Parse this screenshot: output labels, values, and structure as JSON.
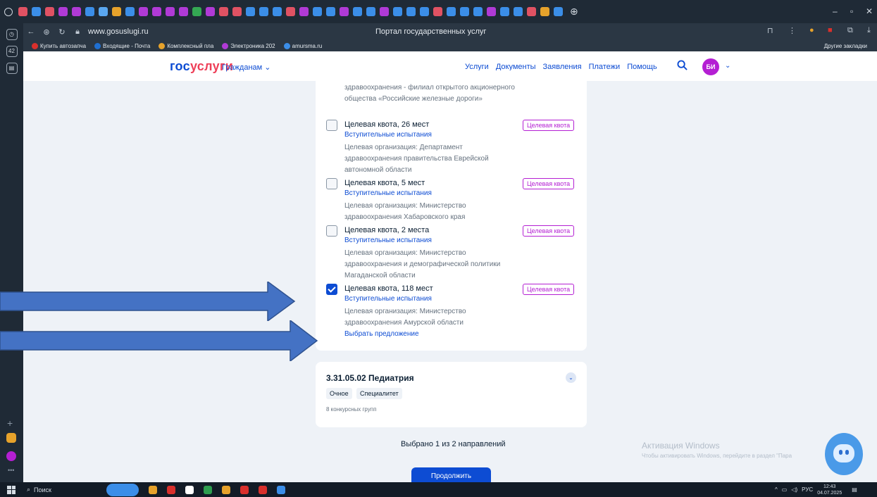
{
  "browser": {
    "url": "www.gosuslugi.ru",
    "page_title": "Портал государственных услуг",
    "bookmarks": [
      {
        "label": "Купить автозапча",
        "color": "#d9302c"
      },
      {
        "label": "Входящие - Почта",
        "color": "#1f6fd1"
      },
      {
        "label": "Комплексный пла",
        "color": "#e6a22b"
      },
      {
        "label": "Электроника 202",
        "color": "#b03ad6"
      },
      {
        "label": "amursma.ru",
        "color": "#3b8ee8"
      }
    ],
    "other_bookmarks": "Другие закладки",
    "tab_colors": [
      "#e05263",
      "#3b8ee8",
      "#e05263",
      "#b03ad6",
      "#b03ad6",
      "#3b8ee8",
      "#5aa7f0",
      "#e6a22b",
      "#3b8ee8",
      "#b03ad6",
      "#b03ad6",
      "#b03ad6",
      "#b03ad6",
      "#34a853",
      "#b03ad6",
      "#e05263",
      "#e05263",
      "#3b8ee8",
      "#3b8ee8",
      "#3b8ee8",
      "#e05263",
      "#b03ad6",
      "#3b8ee8",
      "#3b8ee8",
      "#b03ad6",
      "#3b8ee8",
      "#3b8ee8",
      "#b03ad6",
      "#3b8ee8",
      "#3b8ee8",
      "#3b8ee8",
      "#e05263",
      "#3b8ee8",
      "#3b8ee8",
      "#3b8ee8",
      "#b03ad6",
      "#3b8ee8",
      "#3b8ee8",
      "#e05263",
      "#e6a22b",
      "#3b8ee8"
    ]
  },
  "header": {
    "logo_part1": "гос",
    "logo_part2": "услуги",
    "audience": "Гражданам ⌄",
    "nav": [
      "Услуги",
      "Документы",
      "Заявления",
      "Платежи",
      "Помощь"
    ],
    "avatar_initials": "БИ"
  },
  "main": {
    "partial_org": "здравоохранения - филиал открытого акционерного общества «Российские железные дороги»",
    "quotas": [
      {
        "title": "Целевая квота, 26 мест",
        "badge": "Целевая квота",
        "exams": "Вступительные испытания",
        "org": "Целевая организация: Департамент здравоохранения правительства Еврейской автономной области",
        "checked": false
      },
      {
        "title": "Целевая квота, 5 мест",
        "badge": "Целевая квота",
        "exams": "Вступительные испытания",
        "org": "Целевая организация: Министерство здравоохранения Хабаровского края",
        "checked": false
      },
      {
        "title": "Целевая квота, 2 места",
        "badge": "Целевая квота",
        "exams": "Вступительные испытания",
        "org": "Целевая организация: Министерство здравоохранения и демографической политики Магаданской области",
        "checked": false
      },
      {
        "title": "Целевая квота, 118 мест",
        "badge": "Целевая квота",
        "exams": "Вступительные испытания",
        "org": "Целевая организация: Министерство здравоохранения Амурской области",
        "checked": true
      }
    ],
    "choose_offer": "Выбрать предложение"
  },
  "spec": {
    "title": "3.31.05.02 Педиатрия",
    "form": "Очное",
    "level": "Специалитет",
    "groups": "8 конкурсных групп"
  },
  "footer": {
    "selected": "Выбрано 1 из 2 направлений",
    "continue": "Продолжить"
  },
  "windows_activation": {
    "title": "Активация Windows",
    "subtitle": "Чтобы активировать Windows, перейдите в раздел \"Пара"
  },
  "taskbar": {
    "search": "Поиск",
    "lang": "РУС",
    "time": "12:43",
    "date": "04.07.2025",
    "apps": [
      "#e6a22b",
      "#d9302c",
      "#ffffff",
      "#2e9e4f",
      "#e6a22b",
      "#d9302c",
      "#d9302c",
      "#3b8ee8"
    ]
  },
  "colors": {
    "accent": "#0d4cd3",
    "brand_red": "#ee3f58",
    "badge": "#b41fd3",
    "arrow": "#4472c4"
  }
}
